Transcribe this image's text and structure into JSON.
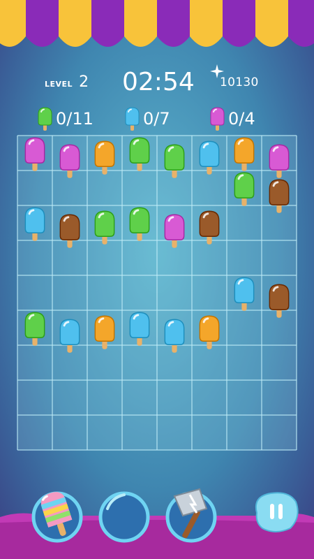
{
  "hud": {
    "level_label": "LEVEL",
    "level_number": "2",
    "timer": "02:54",
    "score": "10130"
  },
  "goals": [
    {
      "color": "green",
      "count": "0/11"
    },
    {
      "color": "blue",
      "count": "0/7"
    },
    {
      "color": "pink",
      "count": "0/4"
    }
  ],
  "colors": {
    "green": "#5fd04a",
    "blue": "#4fc0ee",
    "pink": "#d85ad4",
    "orange": "#f4a62a",
    "brown": "#9a5a2a",
    "awning_yellow": "#f8c33a",
    "awning_purple": "#8a2bb8",
    "bottom_bar": "#c23ab6"
  },
  "board": {
    "columns": 8,
    "rows": 9,
    "pieces": [
      {
        "row": 0,
        "col": 0,
        "color": "pink"
      },
      {
        "row": 0,
        "col": 1,
        "color": "pink"
      },
      {
        "row": 0,
        "col": 2,
        "color": "orange"
      },
      {
        "row": 0,
        "col": 3,
        "color": "green"
      },
      {
        "row": 0,
        "col": 4,
        "color": "green"
      },
      {
        "row": 0,
        "col": 5,
        "color": "blue"
      },
      {
        "row": 0,
        "col": 6,
        "color": "orange"
      },
      {
        "row": 0,
        "col": 7,
        "color": "pink"
      },
      {
        "row": 1,
        "col": 6,
        "color": "green"
      },
      {
        "row": 1,
        "col": 7,
        "color": "brown"
      },
      {
        "row": 2,
        "col": 0,
        "color": "blue"
      },
      {
        "row": 2,
        "col": 1,
        "color": "brown"
      },
      {
        "row": 2,
        "col": 2,
        "color": "green"
      },
      {
        "row": 2,
        "col": 3,
        "color": "green"
      },
      {
        "row": 2,
        "col": 4,
        "color": "pink"
      },
      {
        "row": 2,
        "col": 5,
        "color": "brown"
      },
      {
        "row": 4,
        "col": 6,
        "color": "blue"
      },
      {
        "row": 4,
        "col": 7,
        "color": "brown"
      },
      {
        "row": 5,
        "col": 0,
        "color": "green"
      },
      {
        "row": 5,
        "col": 1,
        "color": "blue"
      },
      {
        "row": 5,
        "col": 2,
        "color": "orange"
      },
      {
        "row": 5,
        "col": 3,
        "color": "blue"
      },
      {
        "row": 5,
        "col": 4,
        "color": "blue"
      },
      {
        "row": 5,
        "col": 5,
        "color": "orange"
      }
    ]
  },
  "boosters": [
    {
      "name": "rainbow-popsicle-icon",
      "state": "available"
    },
    {
      "name": "empty-slot",
      "state": "empty"
    },
    {
      "name": "hammer-icon",
      "state": "available"
    }
  ],
  "pause_icon": "pause-icon"
}
